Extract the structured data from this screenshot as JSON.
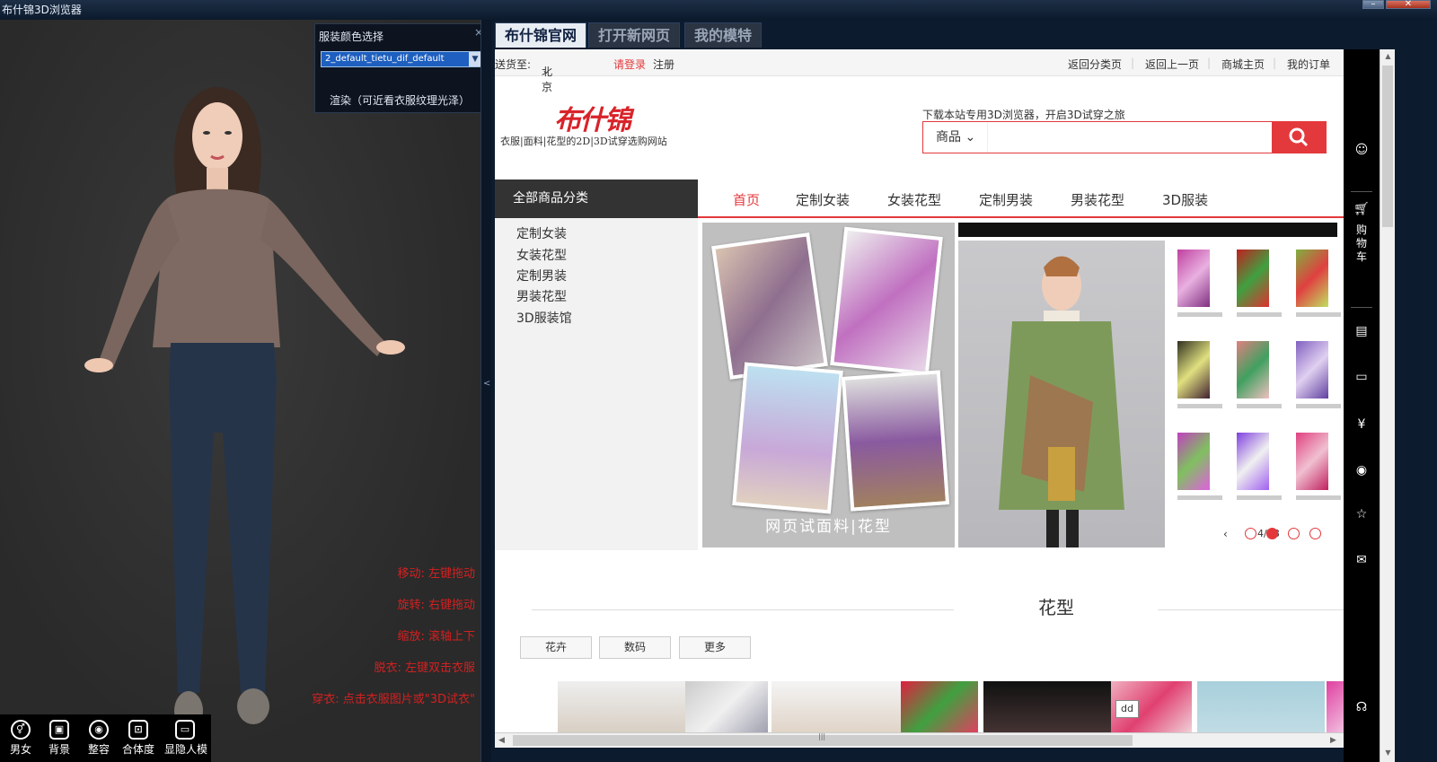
{
  "window": {
    "title": "布什锦3D浏览器"
  },
  "viewer": {
    "color_panel": {
      "title": "服装颜色选择",
      "close_glyph": "×",
      "selected_texture": "2_default_tietu_dif_default",
      "render_label": "渲染（可近看衣服纹理光泽）"
    },
    "hints": [
      "移动: 左键拖动",
      "旋转: 右键拖动",
      "缩放: 滚轴上下",
      "脱衣: 左键双击衣服",
      "穿衣: 点击衣服图片或\"3D试衣\""
    ],
    "toolbar": [
      {
        "label": "男女",
        "icon": "gender-icon"
      },
      {
        "label": "背景",
        "icon": "background-icon"
      },
      {
        "label": "整容",
        "icon": "face-icon"
      },
      {
        "label": "合体度",
        "icon": "fit-icon"
      },
      {
        "label": "显隐人模",
        "icon": "mannequin-icon"
      }
    ],
    "splitter_glyph": "<"
  },
  "browser": {
    "tabs": [
      {
        "label": "布什锦官网",
        "active": true
      },
      {
        "label": "打开新网页",
        "active": false
      },
      {
        "label": "我的模特",
        "active": false
      }
    ],
    "topbar": {
      "ship_to_label": "送货至:",
      "city": "北京",
      "login": "请登录",
      "register": "注册",
      "links": [
        "返回分类页",
        "返回上一页",
        "商城主页",
        "我的订单"
      ],
      "separator": "|"
    },
    "logo": {
      "mark": "布什锦",
      "tagline": "衣服|面料|花型的2D|3D试穿选购网站"
    },
    "search": {
      "tip": "下载本站专用3D浏览器，开启3D试穿之旅",
      "category": "商品"
    },
    "nav": {
      "all_categories": "全部商品分类",
      "items": [
        "首页",
        "定制女装",
        "女装花型",
        "定制男装",
        "男装花型",
        "3D服装"
      ]
    },
    "categories": [
      "定制女装",
      "女装花型",
      "定制男装",
      "男装花型",
      "3D服装馆"
    ],
    "banner_caption": "网页试面料|花型",
    "carousel_pager": "4/18",
    "section_title": "花型",
    "filters": [
      "花卉",
      "数码",
      "更多"
    ],
    "tooltip": "dd",
    "sidebar_cart": "购物车",
    "sidebar_icons": [
      "user-icon",
      "cart-icon",
      "clipboard-icon",
      "ticket-icon",
      "yen-icon",
      "eye-icon",
      "star-icon",
      "mail-icon",
      "service-icon"
    ]
  },
  "colors": {
    "accent": "#e4393c",
    "hint_red": "#d42020",
    "chrome_dark": "#0d1b2e"
  }
}
